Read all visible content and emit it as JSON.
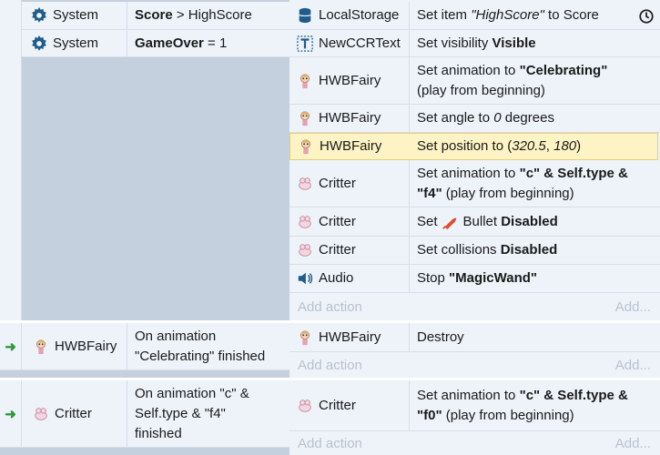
{
  "event1": {
    "conditions": [
      {
        "object": "System",
        "icon": "gear-icon",
        "bold": "Score",
        "rest": " > HighScore"
      },
      {
        "object": "System",
        "icon": "gear-icon",
        "bold": "GameOver",
        "rest": " = 1"
      }
    ],
    "actions": [
      {
        "object": "LocalStorage",
        "icon": "local-storage-icon"
      },
      {
        "object": "NewCCRText",
        "icon": "text-object-icon"
      },
      {
        "object": "HWBFairy",
        "icon": "fairy-sprite-icon"
      },
      {
        "object": "HWBFairy",
        "icon": "fairy-sprite-icon"
      },
      {
        "object": "HWBFairy",
        "icon": "fairy-sprite-icon"
      },
      {
        "object": "Critter",
        "icon": "critter-sprite-icon"
      },
      {
        "object": "Critter",
        "icon": "critter-sprite-icon"
      },
      {
        "object": "Critter",
        "icon": "critter-sprite-icon"
      },
      {
        "object": "Audio",
        "icon": "speaker-icon"
      }
    ],
    "a0": {
      "t1": "Set item ",
      "t2": "\"HighScore\"",
      "t3": " to Score"
    },
    "a1": {
      "t1": "Set visibility ",
      "t2": "Visible"
    },
    "a2": {
      "t1": "Set animation to ",
      "t2": "\"Celebrating\"",
      "t3": "(play from beginning)"
    },
    "a3": {
      "t1": "Set angle to ",
      "t2": "0",
      "t3": " degrees"
    },
    "a4": {
      "t1": "Set position to (",
      "t2": "320.5",
      "t3": ", ",
      "t4": "180",
      "t5": ")"
    },
    "a5": {
      "t1": "Set animation to ",
      "t2": "\"c\" & Self.type &",
      "t3": "\"f4\"",
      "t4": " (play from beginning)"
    },
    "a6": {
      "t1": "Set ",
      "t2": "Bullet ",
      "t3": "Disabled"
    },
    "a7": {
      "t1": "Set collisions ",
      "t2": "Disabled"
    },
    "a8": {
      "t1": "Stop ",
      "t2": "\"MagicWand\""
    }
  },
  "event2": {
    "object": "HWBFairy",
    "condition_line1": "On animation",
    "condition_line2": "\"Celebrating\" finished",
    "action_object": "HWBFairy",
    "action_text": "Destroy"
  },
  "event3": {
    "object": "Critter",
    "condition_line1": "On animation \"c\" &",
    "condition_line2": "Self.type & \"f4\"",
    "condition_line3": "finished",
    "action_object": "Critter",
    "a_t1": "Set animation to ",
    "a_t2": "\"c\" & Self.type &",
    "a_t3": "\"f0\"",
    "a_t4": " (play from beginning)"
  },
  "add_action_label": "Add action",
  "add_more_label": "Add..."
}
